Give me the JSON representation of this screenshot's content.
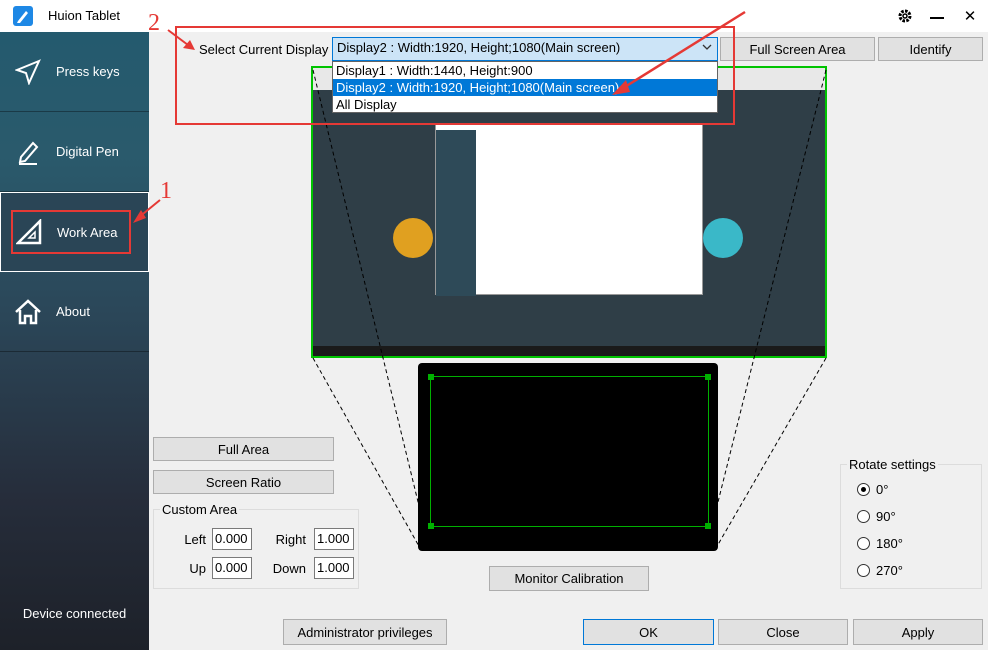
{
  "window": {
    "title": "Huion Tablet"
  },
  "sidebar": {
    "items": [
      {
        "label": "Press keys",
        "icon": "send-icon"
      },
      {
        "label": "Digital Pen",
        "icon": "pen-icon"
      },
      {
        "label": "Work Area",
        "icon": "triangle-ruler-icon"
      },
      {
        "label": "About",
        "icon": "home-icon"
      }
    ],
    "device_status": "Device connected"
  },
  "display": {
    "label": "Select Current Display",
    "selected": "Display2 : Width:1920, Height;1080(Main screen)",
    "options": [
      "Display1 : Width:1440, Height:900",
      "Display2 : Width:1920, Height;1080(Main screen)",
      "All Display"
    ],
    "full_screen_area": "Full Screen Area",
    "identify": "Identify"
  },
  "area_buttons": {
    "full_area": "Full Area",
    "screen_ratio": "Screen Ratio"
  },
  "custom_area": {
    "title": "Custom Area",
    "left_label": "Left",
    "left": "0.000",
    "right_label": "Right",
    "right": "1.000",
    "up_label": "Up",
    "up": "0.000",
    "down_label": "Down",
    "down": "1.000"
  },
  "monitor_calibration": "Monitor Calibration",
  "rotate": {
    "title": "Rotate settings",
    "options": [
      "0°",
      "90°",
      "180°",
      "270°"
    ],
    "selected_index": 0
  },
  "footer": {
    "admin": "Administrator privileges",
    "ok": "OK",
    "close": "Close",
    "apply": "Apply"
  },
  "annotations": {
    "step1": "1",
    "step2": "2"
  },
  "colors": {
    "accent": "#0078d7",
    "annotation": "#e53935",
    "area_outline": "#00c400",
    "sidebar_active": "#2a4556"
  }
}
